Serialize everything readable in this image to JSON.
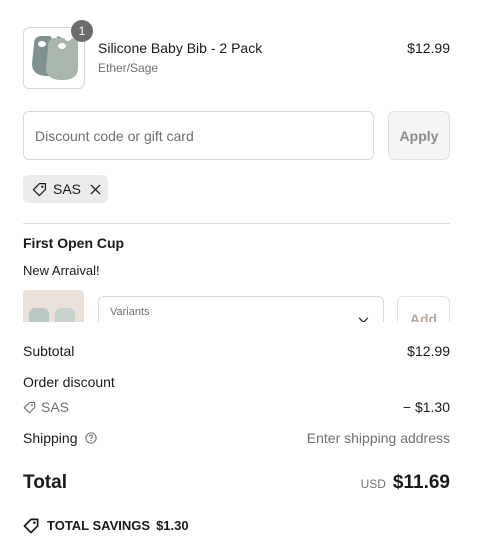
{
  "cart_item": {
    "quantity": "1",
    "name": "Silicone Baby Bib - 2 Pack",
    "variant": "Ether/Sage",
    "price": "$12.99",
    "image_icon": "bib-product-image"
  },
  "discount": {
    "placeholder": "Discount code or gift card",
    "value": "",
    "apply_label": "Apply",
    "applied_code": "SAS",
    "remove_icon": "close-icon"
  },
  "upsell": {
    "title": "First Open Cup",
    "subtitle": "New Arraival!",
    "variants_label": "Variants",
    "add_label": "Add"
  },
  "summary": {
    "subtotal_label": "Subtotal",
    "subtotal_value": "$12.99",
    "order_discount_label": "Order discount",
    "discount_code": "SAS",
    "discount_value": "− $1.30",
    "shipping_label": "Shipping",
    "shipping_value": "Enter shipping address",
    "total_label": "Total",
    "total_currency": "USD",
    "total_value": "$11.69",
    "savings_label": "TOTAL SAVINGS",
    "savings_value": "$1.30"
  },
  "colors": {
    "text": "#1a1a1a",
    "muted": "#707070",
    "tag_bg": "#ececec",
    "border": "#d9d9d9",
    "badge": "#6b6b6b"
  }
}
